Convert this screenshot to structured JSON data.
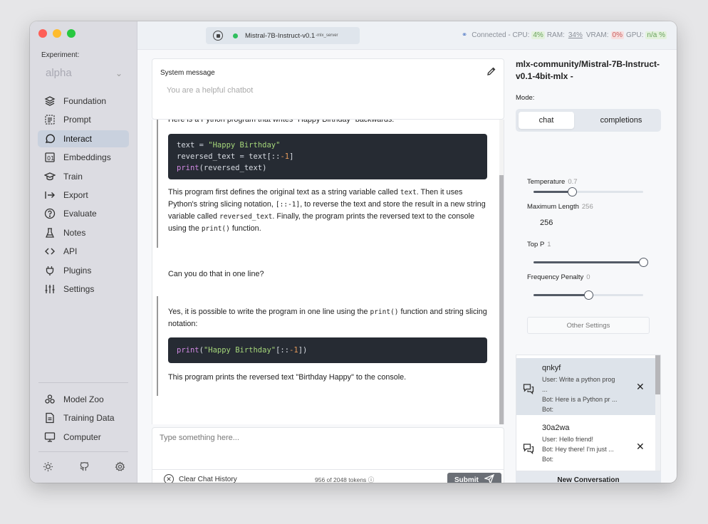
{
  "sidebar": {
    "experiment_label": "Experiment:",
    "experiment_value": "alpha",
    "items": [
      {
        "label": "Foundation",
        "icon": "layers-icon"
      },
      {
        "label": "Prompt",
        "icon": "prompt-icon"
      },
      {
        "label": "Interact",
        "icon": "chat-bubble-icon"
      },
      {
        "label": "Embeddings",
        "icon": "embeddings-icon"
      },
      {
        "label": "Train",
        "icon": "graduation-cap-icon"
      },
      {
        "label": "Export",
        "icon": "export-arrow-icon"
      },
      {
        "label": "Evaluate",
        "icon": "question-circle-icon"
      },
      {
        "label": "Notes",
        "icon": "flask-icon"
      },
      {
        "label": "API",
        "icon": "code-brackets-icon"
      },
      {
        "label": "Plugins",
        "icon": "plug-icon"
      },
      {
        "label": "Settings",
        "icon": "sliders-icon"
      }
    ],
    "active_item": "Interact",
    "bottom_items": [
      {
        "label": "Model Zoo",
        "icon": "model-zoo-icon"
      },
      {
        "label": "Training Data",
        "icon": "document-icon"
      },
      {
        "label": "Computer",
        "icon": "monitor-icon"
      }
    ]
  },
  "topbar": {
    "model_name": "Mistral-7B-Instruct-v0.1",
    "server_tag": "-mlx_server",
    "connection": "Connected - CPU:",
    "cpu": "4%",
    "ram_label": "RAM:",
    "ram": "34%",
    "vram_label": "VRAM:",
    "vram": "0%",
    "gpu_label": "GPU:",
    "gpu": "n/a %"
  },
  "system_message": {
    "title": "System message",
    "placeholder": "You are a helpful chatbot"
  },
  "chat": {
    "bot1_intro": "Here is a Python program that writes \"Happy Birthday\" backwards:",
    "bot1_para": "This program first defines the original text as a string variable called",
    "code_text_var": "text",
    "bot1_para2": ". Then it uses Python's string slicing notation,",
    "code_slice": "[::-1]",
    "bot1_para3": ", to reverse the text and store the result in a new string variable called",
    "code_reversed": "reversed_text",
    "bot1_para4": ". Finally, the program prints the reversed text to the console using the",
    "code_print": "print()",
    "bot1_para5": "function.",
    "user_msg": "Can you do that in one line?",
    "bot2_para1": "Yes, it is possible to write the program in one line using the",
    "bot2_code_print": "print()",
    "bot2_para2": "function and string slicing notation:",
    "bot2_outro": "This program prints the reversed text \"Birthday Happy\" to the console."
  },
  "input": {
    "placeholder": "Type something here...",
    "clear_label": "Clear Chat History",
    "tokens": "956 of 2048 tokens",
    "submit_label": "Submit"
  },
  "right_panel": {
    "model_title": "mlx-community/Mistral-7B-Instruct-v0.1-4bit-mlx -",
    "mode_label": "Mode:",
    "modes": [
      "chat",
      "completions"
    ],
    "selected_mode": "chat",
    "params": {
      "temperature": {
        "label": "Temperature",
        "value": "0.7",
        "fraction": 0.35
      },
      "max_length": {
        "label": "Maximum Length",
        "value": "256"
      },
      "top_p": {
        "label": "Top P",
        "value": "1",
        "fraction": 1.0
      },
      "freq_penalty": {
        "label": "Frequency Penalty",
        "value": "0",
        "fraction": 0.5
      }
    },
    "other_settings": "Other Settings",
    "conversations": [
      {
        "id": "qnkyf",
        "user": "User:  Write a python prog",
        "user2": "...",
        "bot": "Bot:  Here is a Python pr ...",
        "bot2": "Bot:"
      },
      {
        "id": "30a2wa",
        "user": "User:  Hello friend!",
        "bot": "Bot:  Hey there! I'm just ...",
        "bot2": "Bot:"
      }
    ],
    "new_conversation": "New Conversation"
  },
  "colors": {
    "sidebar_bg": "#dcdce2",
    "active_nav": "#c9d1de",
    "code_bg": "#262b33",
    "submit_bg": "#6b6f76",
    "status_green": "#2fbf5e"
  }
}
